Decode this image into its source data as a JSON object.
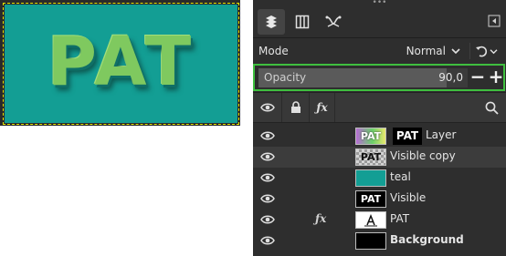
{
  "canvas": {
    "text": "PAT",
    "colors": {
      "background": "#139e94",
      "selection": "#e6e600"
    }
  },
  "dock": {
    "grip": "•••",
    "tabs": [
      {
        "icon": "layers-icon",
        "active": true
      },
      {
        "icon": "channels-icon",
        "active": false
      },
      {
        "icon": "paths-icon",
        "active": false
      }
    ]
  },
  "mode": {
    "label": "Mode",
    "value": "Normal"
  },
  "opacity": {
    "label": "Opacity",
    "value": "90,0",
    "fraction": 0.9,
    "minus": "−",
    "plus": "+"
  },
  "accent": "#3fbf3f",
  "layers": [
    {
      "name": "Layer",
      "thumb": "PAT",
      "thumb2": "PAT",
      "visible": true,
      "fx": false,
      "selected": false,
      "bold": false
    },
    {
      "name": "Visible copy",
      "thumb": "PAT",
      "visible": true,
      "fx": false,
      "selected": true,
      "bold": false
    },
    {
      "name": "teal",
      "thumb": "",
      "visible": true,
      "fx": false,
      "selected": false,
      "bold": false
    },
    {
      "name": "Visible",
      "thumb": "PAT",
      "visible": true,
      "fx": false,
      "selected": false,
      "bold": false
    },
    {
      "name": "PAT",
      "thumb": "",
      "visible": true,
      "fx": true,
      "fx_label": "ƒx",
      "selected": false,
      "bold": false
    },
    {
      "name": "Background",
      "thumb": "",
      "visible": true,
      "fx": false,
      "selected": false,
      "bold": true
    }
  ],
  "header": {
    "fx_label": "ƒx"
  }
}
